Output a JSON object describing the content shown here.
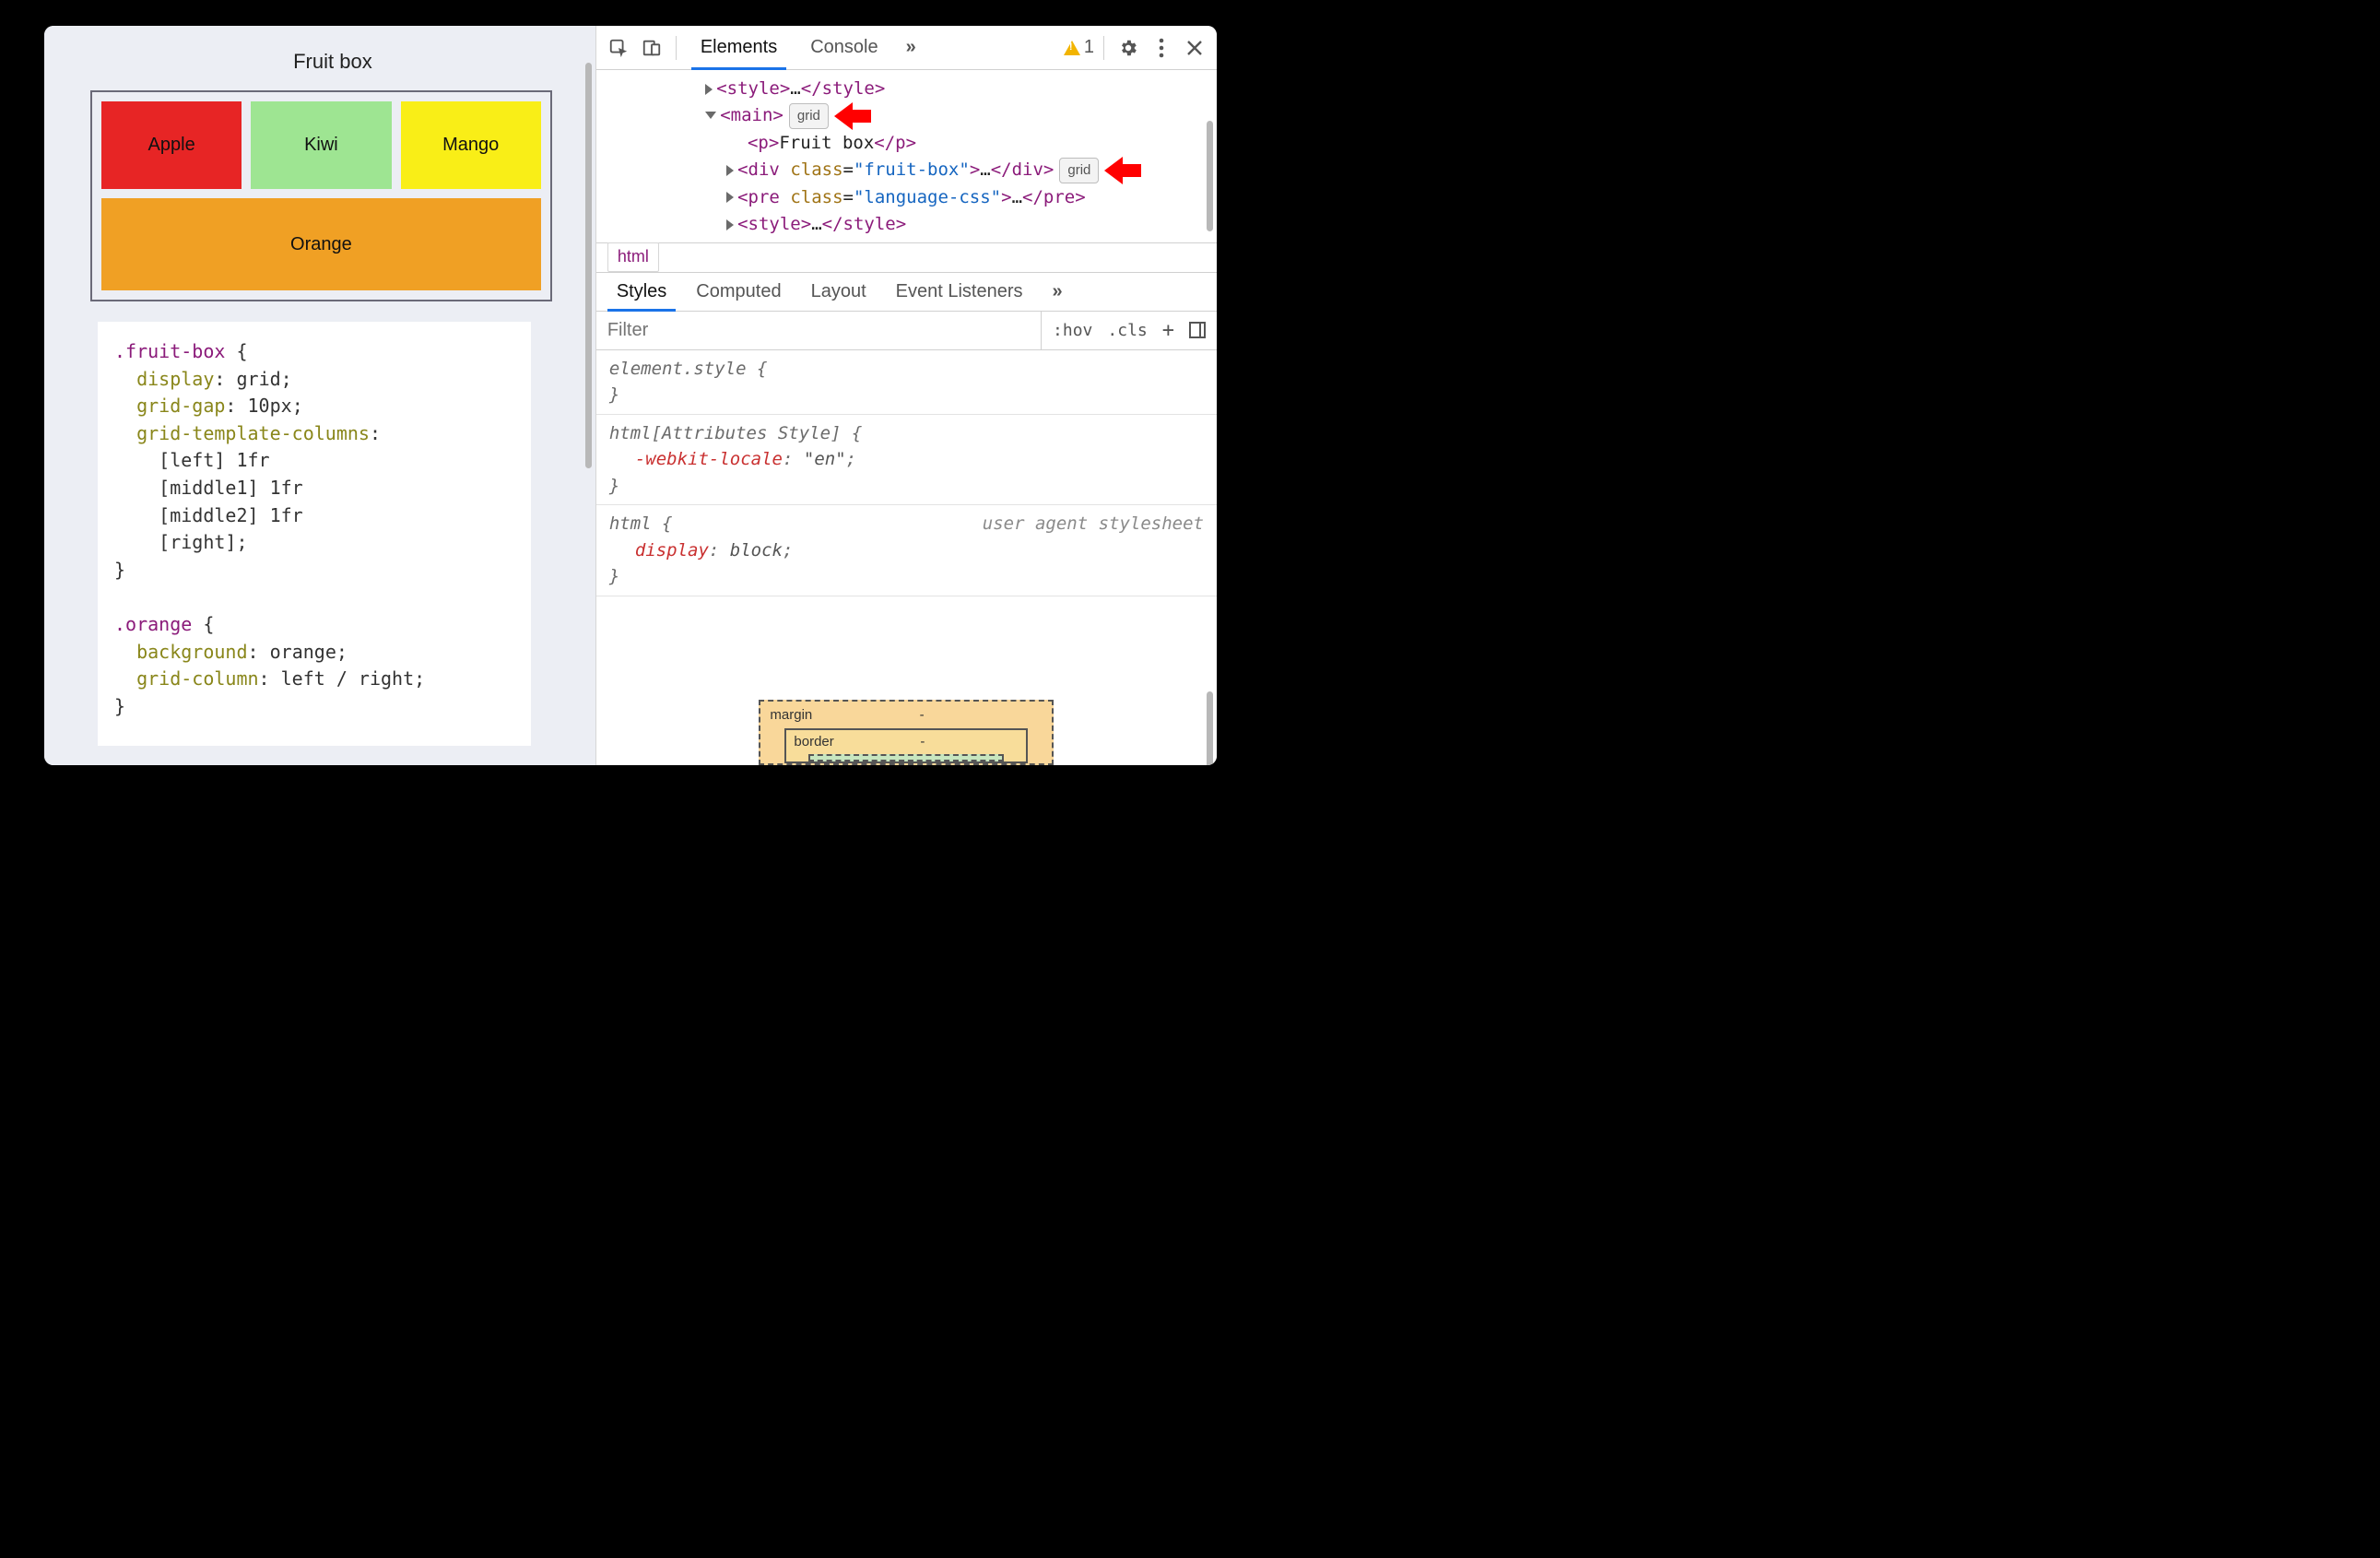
{
  "left": {
    "title": "Fruit box",
    "fruits": {
      "apple": "Apple",
      "kiwi": "Kiwi",
      "mango": "Mango",
      "orange": "Orange"
    },
    "code": {
      "sel1": ".fruit-box",
      "p_display": "display",
      "v_display": "grid",
      "p_gap": "grid-gap",
      "v_gap": "10px",
      "p_cols": "grid-template-columns",
      "v_cols_l1": "[left] 1fr",
      "v_cols_l2": "[middle1] 1fr",
      "v_cols_l3": "[middle2] 1fr",
      "v_cols_l4": "[right]",
      "sel2": ".orange",
      "p_bg": "background",
      "v_bg": "orange",
      "p_gc": "grid-column",
      "v_gc": "left / right"
    }
  },
  "toolbar": {
    "tab_elements": "Elements",
    "tab_console": "Console",
    "more": "»",
    "warning_count": "1"
  },
  "dom": {
    "style_open": "<style>",
    "style_close": "</style>",
    "ellipsis": "…",
    "main_open": "<main>",
    "grid_badge": "grid",
    "p_open": "<p>",
    "p_close": "</p>",
    "p_text": "Fruit box",
    "div_open": "<div ",
    "div_attr": "class",
    "div_val": "\"fruit-box\"",
    "div_close": ">",
    "div_end": "</div>",
    "pre_open": "<pre ",
    "pre_attr": "class",
    "pre_val": "\"language-css\"",
    "pre_close": ">",
    "pre_end": "</pre>"
  },
  "breadcrumb": {
    "item": "html"
  },
  "styles_tabs": {
    "styles": "Styles",
    "computed": "Computed",
    "layout": "Layout",
    "eventlisteners": "Event Listeners",
    "more": "»"
  },
  "filter": {
    "placeholder": "Filter",
    "hov": ":hov",
    "cls": ".cls",
    "plus": "+"
  },
  "rules": {
    "element_style_open": "element.style {",
    "brace_close": "}",
    "html_attr_sel": "html[Attributes Style] {",
    "webkit_locale_prop": "-webkit-locale",
    "webkit_locale_val": "\"en\"",
    "html_sel": "html {",
    "user_agent": "user agent stylesheet",
    "display_prop": "display",
    "display_val": "block"
  },
  "boxmodel": {
    "margin": "margin",
    "border": "border",
    "dash": "-"
  }
}
